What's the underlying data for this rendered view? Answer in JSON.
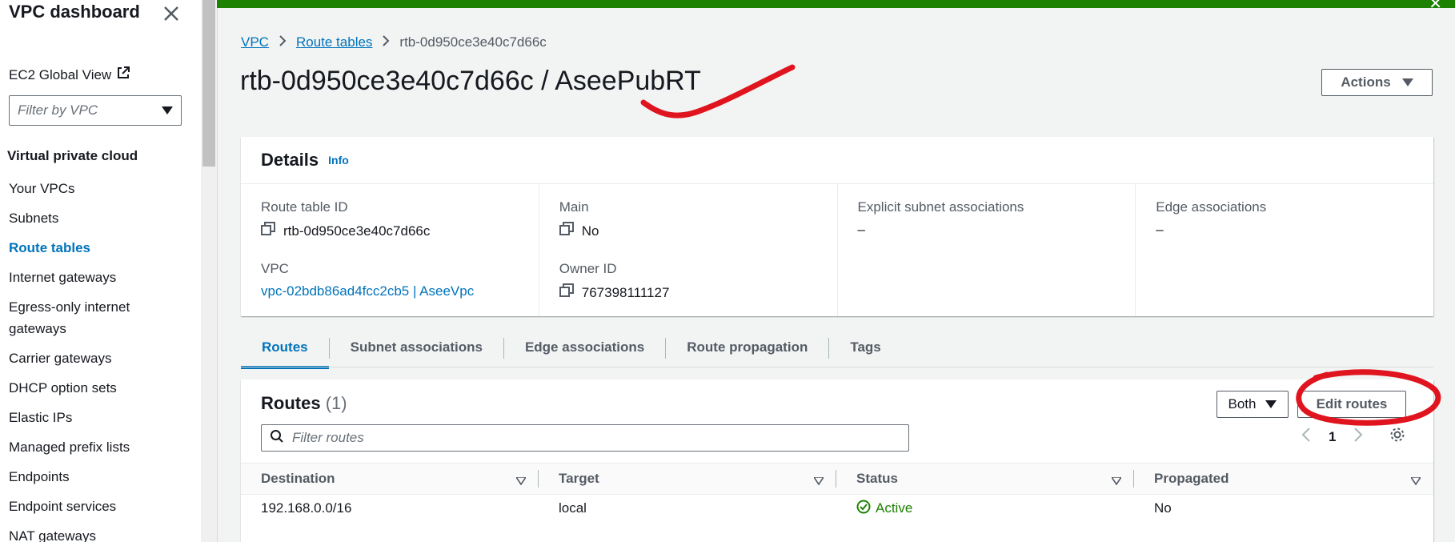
{
  "sidebar": {
    "title": "VPC dashboard",
    "ec2_global_view": "EC2 Global View",
    "filter_placeholder": "Filter by VPC",
    "section_title": "Virtual private cloud",
    "items": [
      {
        "label": "Your VPCs",
        "active": false
      },
      {
        "label": "Subnets",
        "active": false
      },
      {
        "label": "Route tables",
        "active": true
      },
      {
        "label": "Internet gateways",
        "active": false
      },
      {
        "label": "Egress-only internet gateways",
        "active": false
      },
      {
        "label": "Carrier gateways",
        "active": false
      },
      {
        "label": "DHCP option sets",
        "active": false
      },
      {
        "label": "Elastic IPs",
        "active": false
      },
      {
        "label": "Managed prefix lists",
        "active": false
      },
      {
        "label": "Endpoints",
        "active": false
      },
      {
        "label": "Endpoint services",
        "active": false
      },
      {
        "label": "NAT gateways",
        "active": false
      }
    ]
  },
  "breadcrumb": {
    "items": [
      "VPC",
      "Route tables"
    ],
    "current": "rtb-0d950ce3e40c7d66c"
  },
  "header": {
    "title": "rtb-0d950ce3e40c7d66c / AseePubRT",
    "actions_label": "Actions"
  },
  "details": {
    "title": "Details",
    "info_label": "Info",
    "route_table_id_label": "Route table ID",
    "route_table_id": "rtb-0d950ce3e40c7d66c",
    "vpc_label": "VPC",
    "vpc_value": "vpc-02bdb86ad4fcc2cb5 | AseeVpc",
    "main_label": "Main",
    "main_value": "No",
    "owner_label": "Owner ID",
    "owner_value": "767398111127",
    "explicit_label": "Explicit subnet associations",
    "explicit_value": "–",
    "edge_label": "Edge associations",
    "edge_value": "–"
  },
  "tabs": [
    {
      "label": "Routes",
      "active": true
    },
    {
      "label": "Subnet associations",
      "active": false
    },
    {
      "label": "Edge associations",
      "active": false
    },
    {
      "label": "Route propagation",
      "active": false
    },
    {
      "label": "Tags",
      "active": false
    }
  ],
  "routes": {
    "title": "Routes",
    "count": "(1)",
    "both_label": "Both",
    "edit_label": "Edit routes",
    "filter_placeholder": "Filter routes",
    "page": "1",
    "columns": [
      "Destination",
      "Target",
      "Status",
      "Propagated"
    ],
    "rows": [
      {
        "destination": "192.168.0.0/16",
        "target": "local",
        "status": "Active",
        "propagated": "No"
      }
    ]
  },
  "colors": {
    "link": "#0073bb",
    "success": "#1d8102",
    "annotation": "#e0141e"
  }
}
